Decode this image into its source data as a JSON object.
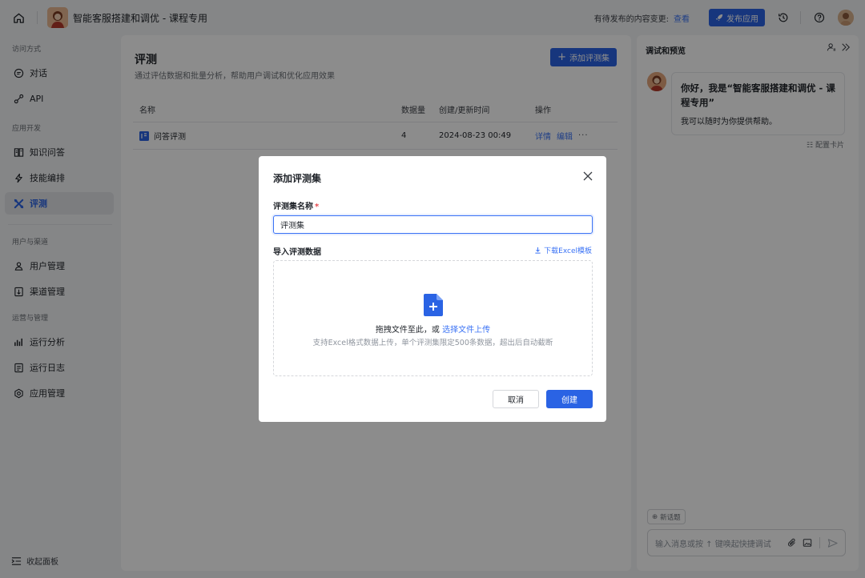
{
  "topbar": {
    "app_title": "智能客服搭建和调优 - 课程专用",
    "pending_text": "有待发布的内容变更:",
    "pending_link": "查看",
    "publish_label": "发布应用"
  },
  "sidebar": {
    "groups": [
      {
        "title": "访问方式",
        "items": [
          {
            "label": "对话",
            "icon": "chat-icon"
          },
          {
            "label": "API",
            "icon": "api-icon"
          }
        ]
      },
      {
        "title": "应用开发",
        "items": [
          {
            "label": "知识问答",
            "icon": "book-icon"
          },
          {
            "label": "技能编排",
            "icon": "lightning-icon"
          },
          {
            "label": "评测",
            "icon": "evaluate-icon",
            "active": true
          }
        ]
      },
      {
        "title": "用户与渠道",
        "items": [
          {
            "label": "用户管理",
            "icon": "users-icon"
          },
          {
            "label": "渠道管理",
            "icon": "channel-icon"
          }
        ]
      },
      {
        "title": "运营与管理",
        "items": [
          {
            "label": "运行分析",
            "icon": "bar-chart-icon"
          },
          {
            "label": "运行日志",
            "icon": "log-icon"
          },
          {
            "label": "应用管理",
            "icon": "settings-icon"
          }
        ]
      }
    ],
    "collapse_label": "收起面板"
  },
  "main": {
    "title": "评测",
    "description": "通过评估数据和批量分析，帮助用户调试和优化应用效果",
    "add_button": "添加评测集",
    "table": {
      "headers": {
        "name": "名称",
        "count": "数据量",
        "time": "创建/更新时间",
        "ops": "操作"
      },
      "rows": [
        {
          "name": "问答评测",
          "count": "4",
          "time": "2024-08-23 00:49",
          "detail": "详情",
          "edit": "编辑",
          "more": "···"
        }
      ]
    }
  },
  "preview": {
    "title": "调试和预览",
    "greeting": "你好，我是“智能客服搭建和调优 - 课程专用”",
    "sub": "我可以随时为你提供帮助。",
    "config_card": "配置卡片",
    "new_topic": "新话题",
    "input_placeholder": "输入消息或按 ↑ 键唤起快捷调试"
  },
  "modal": {
    "title": "添加评测集",
    "name_label": "评测集名称",
    "required_mark": "*",
    "name_value": "评测集",
    "import_label": "导入评测数据",
    "download_link": "下载Excel模板",
    "drop_text": "拖拽文件至此，或",
    "drop_link": "选择文件上传",
    "drop_hint": "支持Excel格式数据上传，单个评测集限定500条数据，超出后自动截断",
    "cancel": "取消",
    "create": "创建"
  },
  "colors": {
    "accent": "#2a63e4",
    "link": "#3b73f5",
    "required": "#e5484d"
  }
}
